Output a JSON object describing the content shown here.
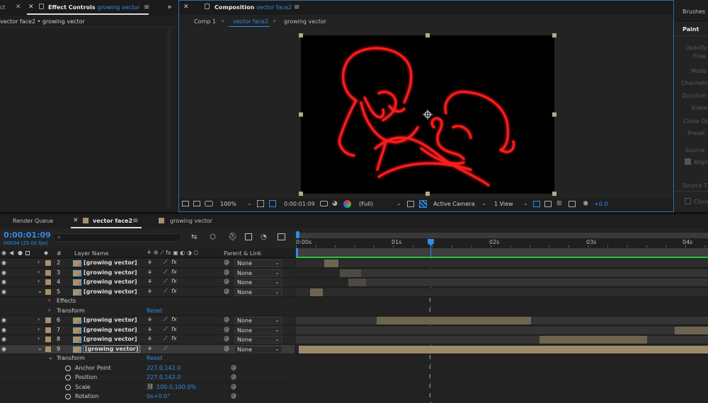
{
  "effect_controls": {
    "tab_prefix": "ct",
    "tab_label": "Effect Controls",
    "tab_target": "growing vector",
    "subtitle": "vector face2 • growing vector"
  },
  "composition": {
    "tab_label": "Composition",
    "tab_name": "vector face2",
    "breadcrumbs": [
      "Comp 1",
      "vector face2",
      "growing vector"
    ],
    "toolbar": {
      "zoom": "100%",
      "timecode": "0:00:01:09",
      "resolution": "(Full)",
      "camera": "Active Camera",
      "views": "1 View",
      "exposure": "+0.0"
    }
  },
  "right_panel": {
    "tab": "Brushes",
    "section": "Paint",
    "fields": [
      "Opacity",
      "Flow",
      "Mode",
      "Channels",
      "Duration",
      "Erase",
      "Clone Op",
      "Preset",
      "Source",
      "Aligned",
      "Source T",
      "Clone"
    ]
  },
  "timeline": {
    "tabs": [
      "Render Queue",
      "vector face2",
      "growing vector"
    ],
    "timecode": "0:00:01:09",
    "frame_info": "00034 (25.00 fps)",
    "search_placeholder": "",
    "headers": {
      "num": "#",
      "layer_name": "Layer Name",
      "parent": "Parent & Link"
    },
    "ruler": [
      "0:00s",
      "01s",
      "02s",
      "03s",
      "04s"
    ],
    "layers_top": [
      {
        "num": "2",
        "name": "[growing vector]",
        "parent": "None"
      },
      {
        "num": "3",
        "name": "[growing vector]",
        "parent": "None"
      },
      {
        "num": "4",
        "name": "[growing vector]",
        "parent": "None"
      },
      {
        "num": "5",
        "name": "[growing vector]",
        "parent": "None"
      }
    ],
    "layer5_props": {
      "effects": "Effects",
      "transform": "Transform",
      "reset": "Reset"
    },
    "layers_mid": [
      {
        "num": "6",
        "name": "[growing vector]",
        "parent": "None"
      },
      {
        "num": "7",
        "name": "[growing vector]",
        "parent": "None"
      },
      {
        "num": "8",
        "name": "[growing vector]",
        "parent": "None"
      },
      {
        "num": "9",
        "name": "[growing vector]",
        "parent": "None"
      }
    ],
    "layer9_transform": {
      "label": "Transform",
      "reset": "Reset",
      "props": [
        {
          "name": "Anchor Point",
          "value": "227.0,142.0"
        },
        {
          "name": "Position",
          "value": "227.0,142.0"
        },
        {
          "name": "Scale",
          "value": "100.0,100.0%"
        },
        {
          "name": "Rotation",
          "value": "0x+0.0°"
        }
      ]
    }
  },
  "colors": {
    "accent_blue": "#2d8ceb",
    "panel": "#232323",
    "label_tan": "#a8906a",
    "vector_red": "#ff1a1a",
    "green_bar": "#23c43a"
  }
}
